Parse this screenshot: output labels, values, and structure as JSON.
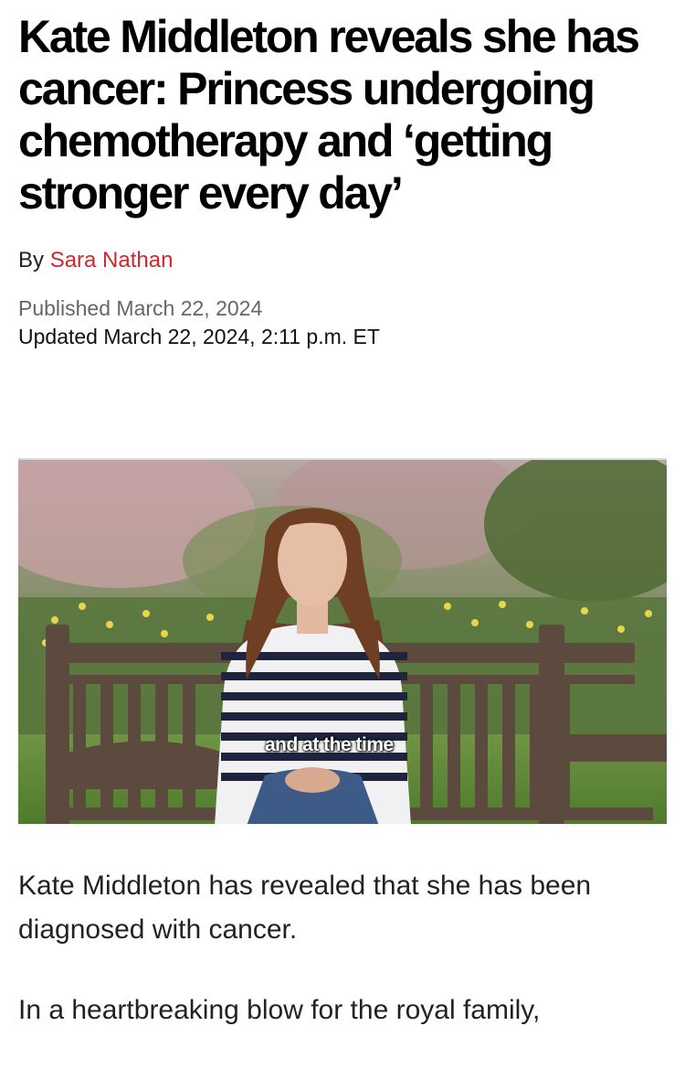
{
  "article": {
    "headline": "Kate Middleton reveals she has cancer: Princess undergoing chemotherapy and ‘getting stronger every day’",
    "byline_prefix": "By ",
    "author": "Sara Nathan",
    "published": "Published March 22, 2024",
    "updated": "Updated March 22, 2024, 2:11 p.m. ET"
  },
  "media": {
    "caption_overlay": "and at the time"
  },
  "body": {
    "paragraphs": [
      "Kate Middleton has revealed that she has been diagnosed with cancer.",
      "In a heartbreaking blow for the royal family,"
    ]
  },
  "colors": {
    "author_link": "#d0282f",
    "headline": "#000000",
    "meta": "#666666"
  }
}
